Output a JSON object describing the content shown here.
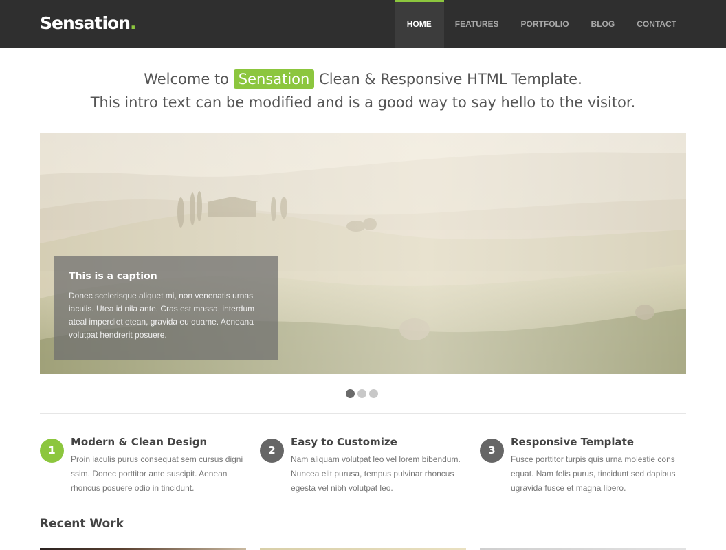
{
  "header": {
    "logo": "Sensation",
    "logo_dot": ".",
    "nav": [
      {
        "label": "HOME",
        "active": true
      },
      {
        "label": "FEATURES",
        "active": false
      },
      {
        "label": "PORTFOLIO",
        "active": false
      },
      {
        "label": "BLOG",
        "active": false
      },
      {
        "label": "CONTACT",
        "active": false
      }
    ]
  },
  "intro": {
    "pre": "Welcome to",
    "brand": "Sensation",
    "post": "Clean & Responsive HTML Template.",
    "line2": "This intro text can be modified and is a good way to say hello to the visitor."
  },
  "slider": {
    "caption_title": "This is a caption",
    "caption_text": "Donec scelerisque aliquet mi, non venenatis urnas iaculis. Utea id nila ante. Cras est massa, interdum ateal imperdiet etean, gravida eu quame. Aeneana volutpat hendrerit posuere.",
    "slide_count": 3,
    "active_slide": 1
  },
  "features": [
    {
      "num": "1",
      "title": "Modern & Clean Design",
      "text": "Proin iaculis purus consequat sem cursus digni ssim. Donec porttitor ante suscipit. Aenean rhoncus posuere odio in tincidunt."
    },
    {
      "num": "2",
      "title": "Easy to Customize",
      "text": "Nam aliquam volutpat leo vel lorem bibendum. Nuncea elit purusa, tempus pulvinar rhoncus egesta vel nibh volutpat leo."
    },
    {
      "num": "3",
      "title": "Responsive Template",
      "text": "Fusce porttitor turpis quis urna molestie cons equat. Nam felis purus, tincidunt sed dapibus ugravida fusce et magna libero."
    }
  ],
  "recent_work": {
    "title": "Recent Work"
  },
  "colors": {
    "accent": "#8cc63e",
    "header_bg": "#2f2f2f"
  }
}
